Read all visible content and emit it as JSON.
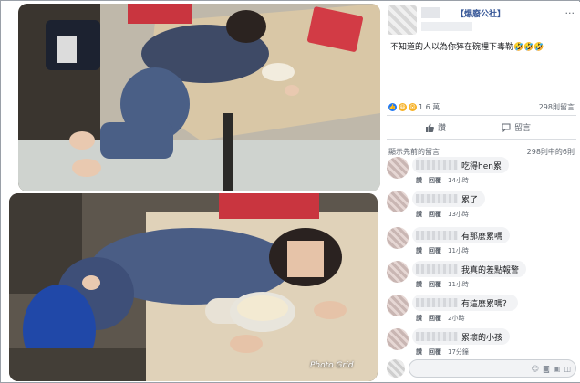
{
  "post": {
    "page_name": "【爆廢公社】",
    "menu_icon": "···",
    "text": "不知道的人以為你猝在碗裡下毒勒🤣🤣🤣",
    "reaction_count": "1.6 萬",
    "share_count": "298則留言",
    "like_label": "讚",
    "comment_label": "留言"
  },
  "comments_bar": {
    "sort_label": "顯示先前的留言",
    "count_label": "298則中的6則"
  },
  "comments": [
    {
      "text": "吃得hen累",
      "like": "讚",
      "reply": "回覆",
      "time": "14小時"
    },
    {
      "text": "累了",
      "like": "讚",
      "reply": "回覆",
      "time": "13小時"
    },
    {
      "text": "有那麼累嗎",
      "like": "讚",
      "reply": "回覆",
      "time": "11小時"
    },
    {
      "text": "我真的差點報警",
      "like": "讚",
      "reply": "回覆",
      "time": "11小時"
    },
    {
      "text": "有這麼累嗎？",
      "like": "讚",
      "reply": "回覆",
      "time": "2小時"
    },
    {
      "text": "累壞的小孩",
      "like": "讚",
      "reply": "回覆",
      "time": "17分鐘"
    }
  ],
  "watermark": "Photo Grid",
  "colors": {
    "fb_blue": "#385898",
    "meta_gray": "#606770",
    "bubble": "#f2f3f5"
  }
}
